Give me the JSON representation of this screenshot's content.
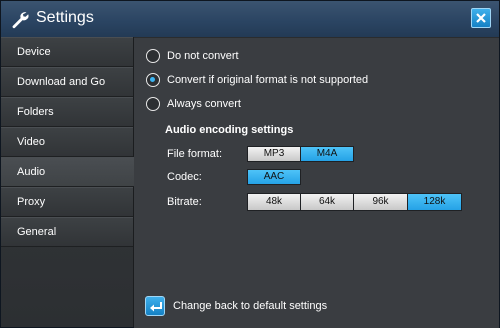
{
  "window": {
    "title": "Settings",
    "close_icon": "close-icon",
    "title_icon": "wrench-icon",
    "accent": "#29a6ea"
  },
  "sidebar": {
    "items": [
      {
        "label": "Device",
        "active": false
      },
      {
        "label": "Download and Go",
        "active": false
      },
      {
        "label": "Folders",
        "active": false
      },
      {
        "label": "Video",
        "active": false
      },
      {
        "label": "Audio",
        "active": true
      },
      {
        "label": "Proxy",
        "active": false
      },
      {
        "label": "General",
        "active": false
      }
    ]
  },
  "audio": {
    "conversion_options": [
      {
        "label": "Do not convert",
        "selected": false
      },
      {
        "label": "Convert if original format is not supported",
        "selected": true
      },
      {
        "label": "Always convert",
        "selected": false
      }
    ],
    "encoding_title": "Audio encoding settings",
    "file_format": {
      "label": "File format:",
      "options": [
        "MP3",
        "M4A"
      ],
      "selected": "M4A"
    },
    "codec": {
      "label": "Codec:",
      "options": [
        "AAC"
      ],
      "selected": "AAC"
    },
    "bitrate": {
      "label": "Bitrate:",
      "options": [
        "48k",
        "64k",
        "96k",
        "128k"
      ],
      "selected": "128k"
    }
  },
  "footer": {
    "reset_label": "Change back to default settings",
    "reset_icon": "undo-arrow-icon"
  }
}
